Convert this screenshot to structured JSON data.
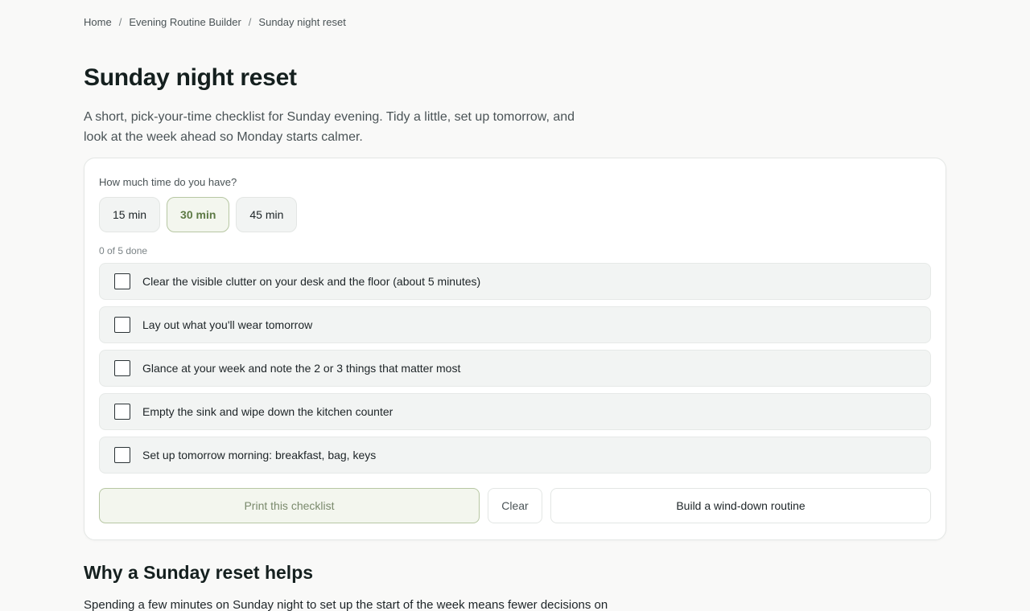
{
  "breadcrumb": {
    "items": [
      "Home",
      "Evening Routine Builder"
    ],
    "separator": "/",
    "current": "Sunday night reset"
  },
  "page": {
    "title": "Sunday night reset",
    "intro": "A short, pick-your-time checklist for Sunday evening. Tidy a little, set up tomorrow, and look at the week ahead so Monday starts calmer."
  },
  "time_picker": {
    "label": "How much time do you have?",
    "options": [
      "15 min",
      "30 min",
      "45 min"
    ],
    "selected": "30 min"
  },
  "progress": {
    "text": "0 of 5 done",
    "done": 0,
    "total": 5
  },
  "tasks": [
    {
      "label": "Clear the visible clutter on your desk and the floor (about 5 minutes)",
      "checked": false
    },
    {
      "label": "Lay out what you'll wear tomorrow",
      "checked": false
    },
    {
      "label": "Glance at your week and note the 2 or 3 things that matter most",
      "checked": false
    },
    {
      "label": "Empty the sink and wipe down the kitchen counter",
      "checked": false
    },
    {
      "label": "Set up tomorrow morning: breakfast, bag, keys",
      "checked": false
    }
  ],
  "actions": {
    "print_label": "Print this checklist",
    "clear_label": "Clear",
    "build_label": "Build a wind-down routine"
  },
  "why": {
    "title": "Why a Sunday reset helps",
    "body": "Spending a few minutes on Sunday night to set up the start of the week means fewer decisions on"
  },
  "colors": {
    "accent": "#5d7a45",
    "accent_bg": "#f3f6ee",
    "accent_border": "#b7c7a3",
    "page_bg": "#f9f9f8"
  }
}
